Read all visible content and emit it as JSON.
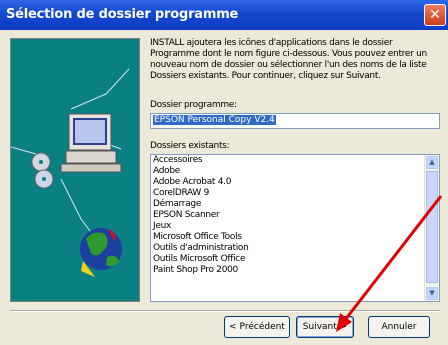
{
  "window": {
    "title": "Sélection de dossier programme",
    "close_glyph": "✕"
  },
  "description": "INSTALL ajoutera les icônes d'applications dans le dossier Programme dont le nom figure ci-dessous. Vous pouvez entrer un nouveau nom de dossier ou sélectionner l'un des noms de la liste Dossiers existants. Pour continuer, cliquez sur Suivant.",
  "program_folder": {
    "label": "Dossier programme:",
    "value": "EPSON Personal Copy V2.4"
  },
  "existing_folders": {
    "label": "Dossiers existants:",
    "items": [
      "Accessoires",
      "Adobe",
      "Adobe Acrobat 4.0",
      "CorelDRAW 9",
      "Démarrage",
      "EPSON Scanner",
      "Jeux",
      "Microsoft Office Tools",
      "Outils d'administration",
      "Outils Microsoft Office",
      "Paint Shop Pro 2000"
    ]
  },
  "buttons": {
    "back": "< Précédent",
    "next": "Suivant >",
    "cancel": "Annuler"
  },
  "icons": {
    "left_art": "computer-globe-cd-illustration",
    "annotation": "red-arrow"
  },
  "colors": {
    "title_bar": "#1548d0",
    "panel_teal": "#0a8083",
    "arrow_red": "#e00000",
    "selection": "#316ac5"
  }
}
